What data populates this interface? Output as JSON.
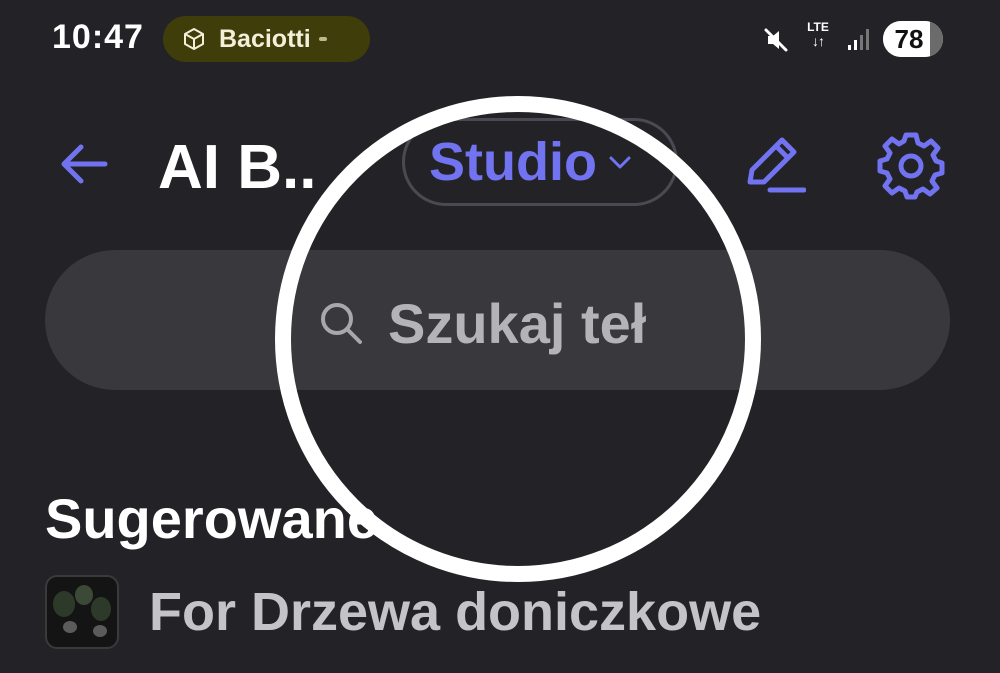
{
  "status_bar": {
    "time": "10:47",
    "app_pill": {
      "label": "Baciotti",
      "icon": "cube-icon",
      "color": "#3f3d0a"
    },
    "network": "LTE",
    "network_arrows": "↓↑",
    "battery_level": "78",
    "battery_fraction": 0.78
  },
  "header": {
    "title": "AI B..",
    "studio_label": "Studio",
    "accent": "#7173f0",
    "icons": {
      "back": "arrow-left-icon",
      "edit": "pencil-icon",
      "settings": "gear-icon",
      "dropdown": "chevron-down-icon"
    }
  },
  "search": {
    "placeholder": "Szukaj teł",
    "icon": "search-icon"
  },
  "suggestions": {
    "title": "Sugerowane",
    "items": [
      {
        "label": "For Drzewa doniczkowe",
        "thumb": "plant-thumbnail"
      }
    ]
  },
  "colors": {
    "background": "#232327",
    "search_background": "#38383d",
    "zoom_ring": "#ffffff"
  }
}
